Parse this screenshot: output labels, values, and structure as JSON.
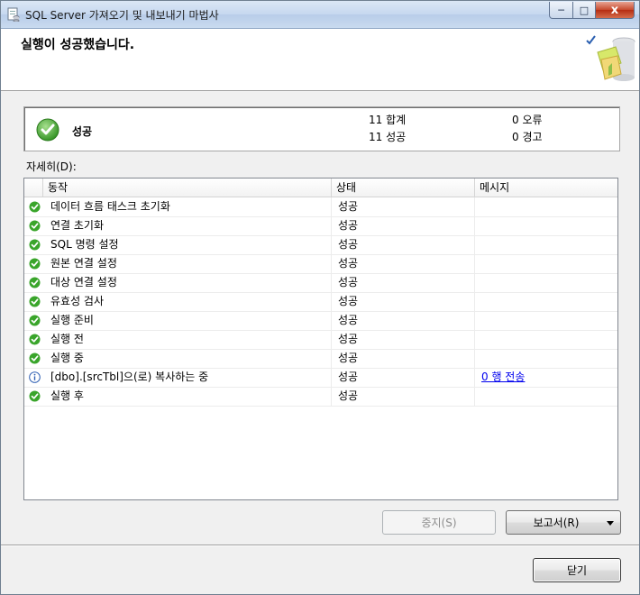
{
  "window": {
    "title": "SQL Server 가져오기 및 내보내기 마법사",
    "controls": {
      "minimize": "─",
      "maximize": "□",
      "close": "x"
    }
  },
  "header": {
    "title": "실행이 성공했습니다."
  },
  "summary": {
    "status": "성공",
    "total": "11 합계",
    "success": "11 성공",
    "errors": "0 오류",
    "warnings": "0 경고"
  },
  "details_label": "자세히(D):",
  "grid": {
    "columns": [
      "동작",
      "상태",
      "메시지"
    ],
    "rows": [
      {
        "icon": "success",
        "action": "데이터 흐름 태스크 초기화",
        "state": "성공",
        "message": ""
      },
      {
        "icon": "success",
        "action": "연결 초기화",
        "state": "성공",
        "message": ""
      },
      {
        "icon": "success",
        "action": "SQL 명령 설정",
        "state": "성공",
        "message": ""
      },
      {
        "icon": "success",
        "action": "원본 연결 설정",
        "state": "성공",
        "message": ""
      },
      {
        "icon": "success",
        "action": "대상 연결 설정",
        "state": "성공",
        "message": ""
      },
      {
        "icon": "success",
        "action": "유효성 검사",
        "state": "성공",
        "message": ""
      },
      {
        "icon": "success",
        "action": "실행 준비",
        "state": "성공",
        "message": ""
      },
      {
        "icon": "success",
        "action": "실행 전",
        "state": "성공",
        "message": ""
      },
      {
        "icon": "success",
        "action": "실행 중",
        "state": "성공",
        "message": ""
      },
      {
        "icon": "info",
        "action": "[dbo].[srcTbl]으(로) 복사하는 중",
        "state": "성공",
        "message": "0 행 전송"
      },
      {
        "icon": "success",
        "action": "실행 후",
        "state": "성공",
        "message": ""
      }
    ]
  },
  "buttons": {
    "stop": "중지(S)",
    "report": "보고서(R)",
    "close": "닫기"
  },
  "colors": {
    "success_green": "#3aa52b",
    "info_blue": "#2f5fb3",
    "link": "#0000ee"
  }
}
